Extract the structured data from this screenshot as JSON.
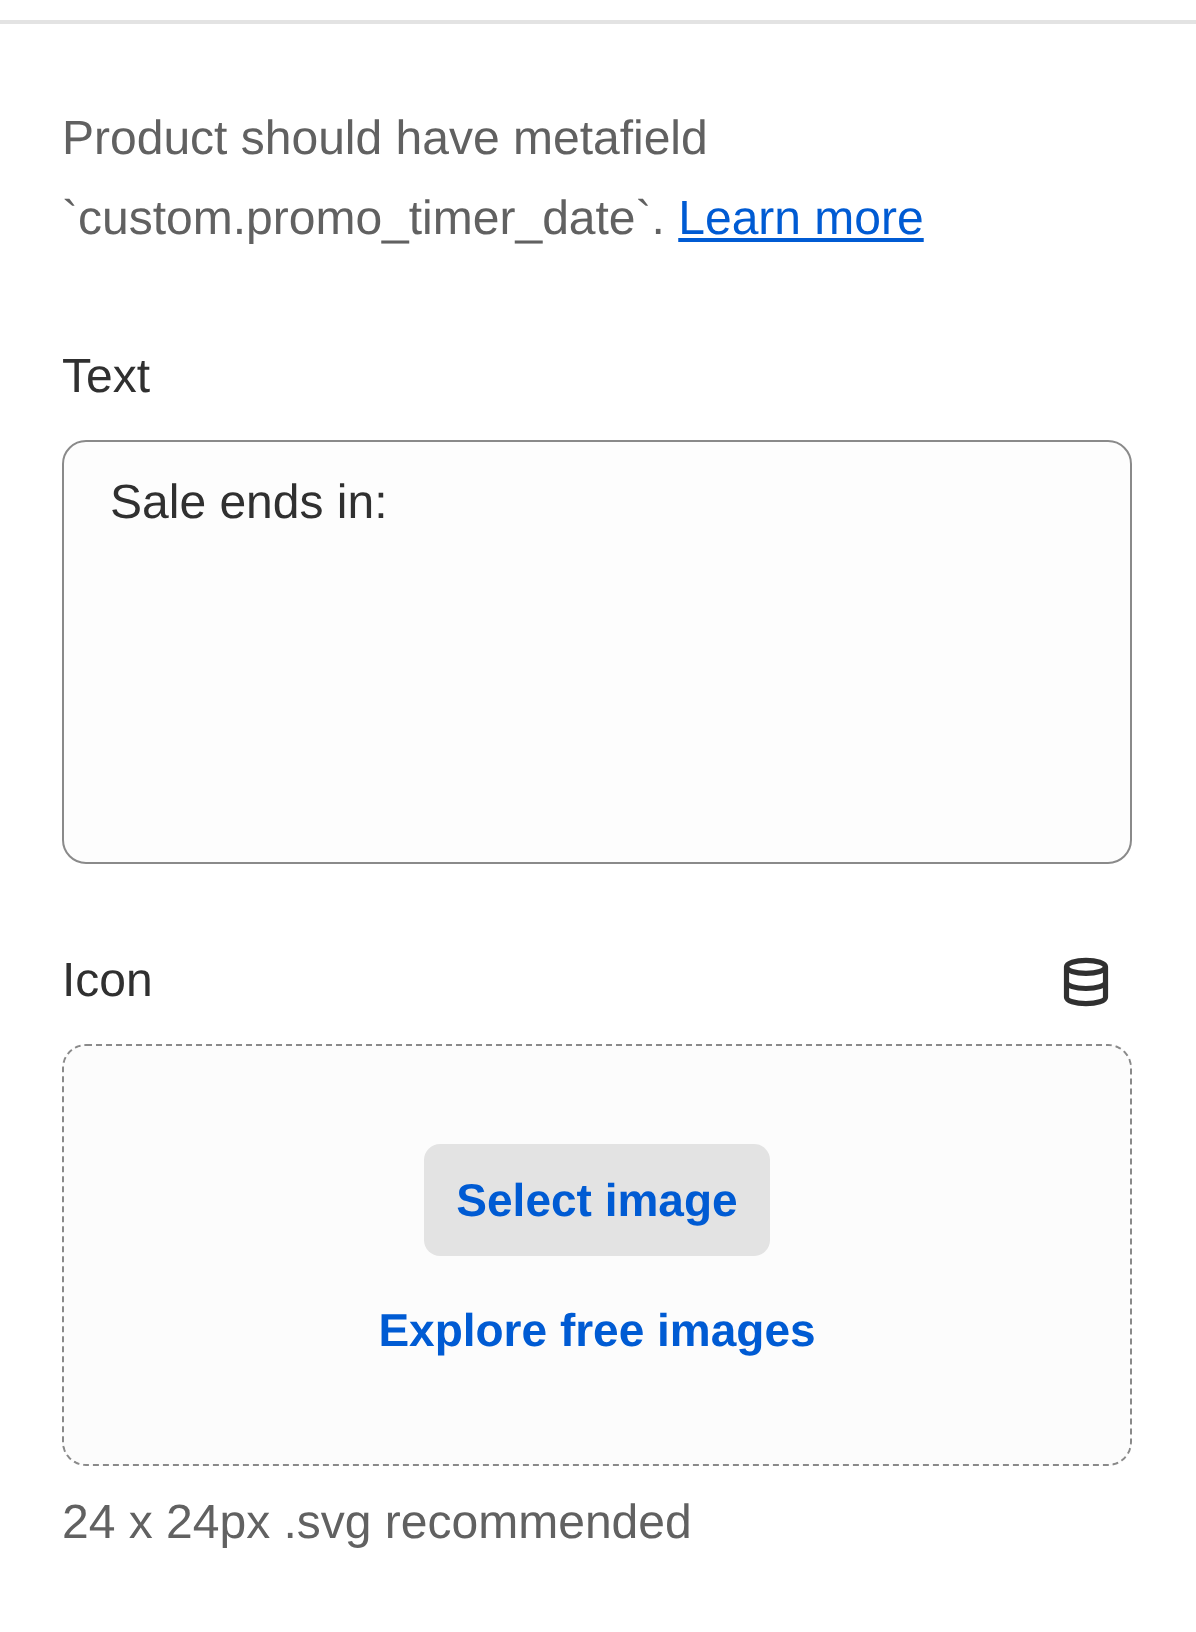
{
  "help": {
    "text": "Product should have metafield `custom.promo_timer_date`.",
    "link": "Learn more"
  },
  "text_field": {
    "label": "Text",
    "value": "Sale ends in:"
  },
  "icon_field": {
    "label": "Icon",
    "select_button": "Select image",
    "explore_link": "Explore free images",
    "hint": "24 x 24px .svg recommended"
  }
}
